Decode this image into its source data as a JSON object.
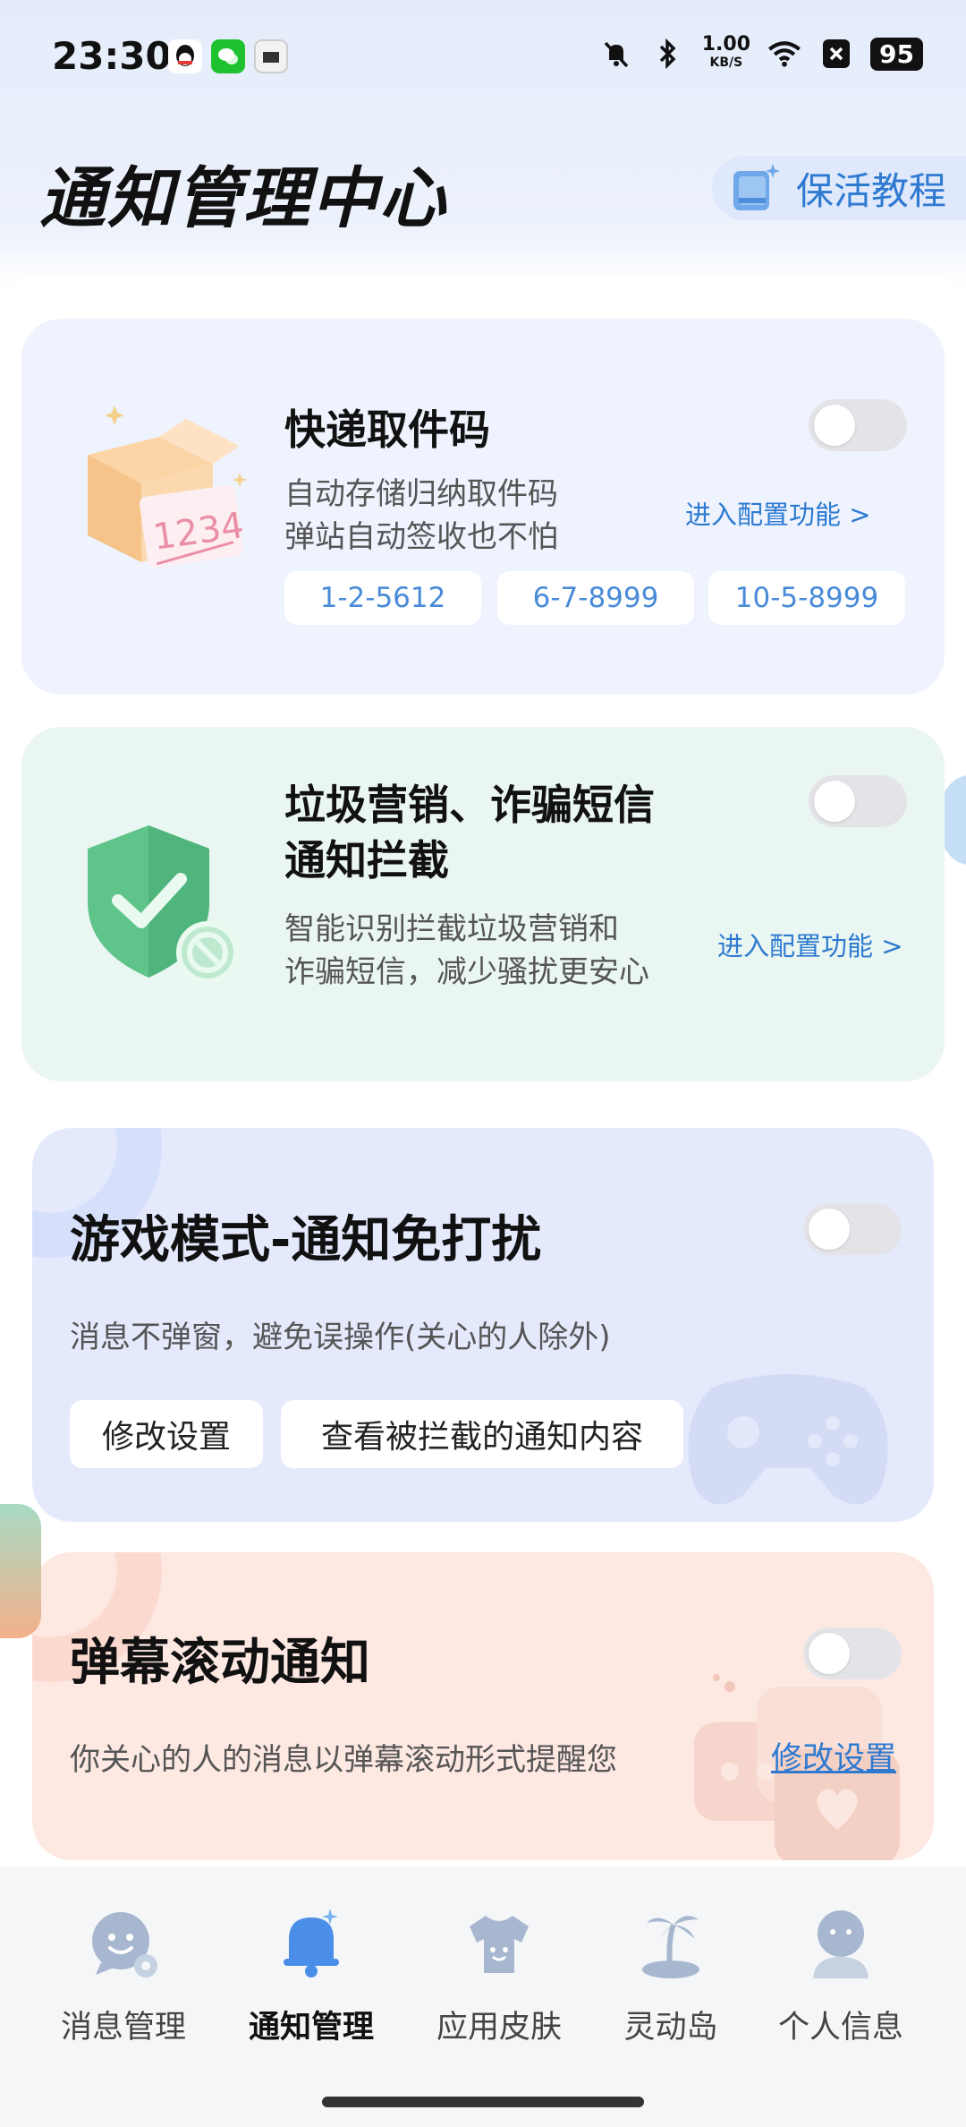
{
  "status_bar": {
    "time": "23:30",
    "net_speed_value": "1.00",
    "net_speed_unit": "KB/S",
    "battery": "95",
    "app_icons": [
      "qq-icon",
      "wechat-icon",
      "mt-icon"
    ],
    "system_icons": [
      "mute-icon",
      "bluetooth-icon",
      "wifi-icon",
      "close-box-icon"
    ]
  },
  "header": {
    "title": "通知管理中心",
    "tutorial_label": "保活教程"
  },
  "express_card": {
    "title": "快递取件码",
    "desc_line1": "自动存储归纳取件码",
    "desc_line2": "弹站自动签收也不怕",
    "config_link": "进入配置功能 >",
    "codes": [
      "1-2-5612",
      "6-7-8999",
      "10-5-8999"
    ],
    "illustration_text": "1234",
    "toggle_on": false
  },
  "spam_card": {
    "title_line1": "垃圾营销、诈骗短信",
    "title_line2": "通知拦截",
    "desc_line1": "智能识别拦截垃圾营销和",
    "desc_line2": "诈骗短信，减少骚扰更安心",
    "config_link": "进入配置功能 >",
    "toggle_on": false
  },
  "game_card": {
    "title": "游戏模式-通知免打扰",
    "desc": "消息不弹窗，避免误操作(关心的人除外)",
    "btn_settings": "修改设置",
    "btn_view_blocked": "查看被拦截的通知内容",
    "toggle_on": false
  },
  "danmu_card": {
    "title": "弹幕滚动通知",
    "desc": "你关心的人的消息以弹幕滚动形式提醒您",
    "settings_link": "修改设置",
    "toggle_on": false
  },
  "bottom_nav": {
    "items": [
      {
        "label": "消息管理",
        "icon": "chat-gear-icon",
        "active": false
      },
      {
        "label": "通知管理",
        "icon": "bell-icon",
        "active": true
      },
      {
        "label": "应用皮肤",
        "icon": "tshirt-icon",
        "active": false
      },
      {
        "label": "灵动岛",
        "icon": "island-icon",
        "active": false
      },
      {
        "label": "个人信息",
        "icon": "person-icon",
        "active": false
      }
    ]
  },
  "colors": {
    "accent": "#2e7ad1",
    "express_bg": "#eef3fd",
    "spam_bg": "#eaf6f1",
    "game_bg": "#e4e9fc",
    "danmu_bg": "#fde8e2",
    "nav_icon": "#a7b7cf",
    "nav_icon_active": "#4a8ee8"
  }
}
